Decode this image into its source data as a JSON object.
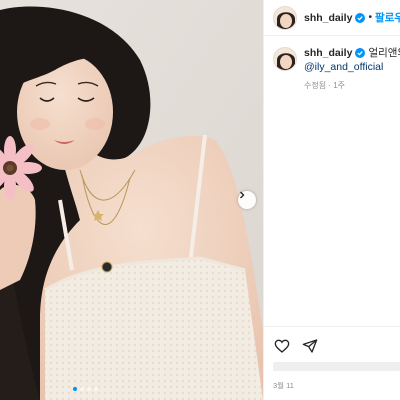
{
  "post": {
    "media": {
      "alt_icon": "photo",
      "carousel": {
        "count": 4,
        "active_index": 0
      },
      "next_icon": "chevron-right-icon"
    },
    "header": {
      "username": "shh_daily",
      "verified_icon": "verified-badge-icon",
      "separator": "•",
      "follow_label": "팔로우"
    },
    "caption": {
      "username": "shh_daily",
      "text": "얼리앤의",
      "mention": "@ily_and_official",
      "meta": "수정됨 · 1주"
    },
    "actions": {
      "like_icon": "heart-icon",
      "share_icon": "send-icon"
    },
    "date": "3월 11"
  },
  "colors": {
    "accent": "#0095f6",
    "text": "#262626",
    "muted": "#8e8e8e",
    "border": "#efefef",
    "mention": "#00376b"
  }
}
